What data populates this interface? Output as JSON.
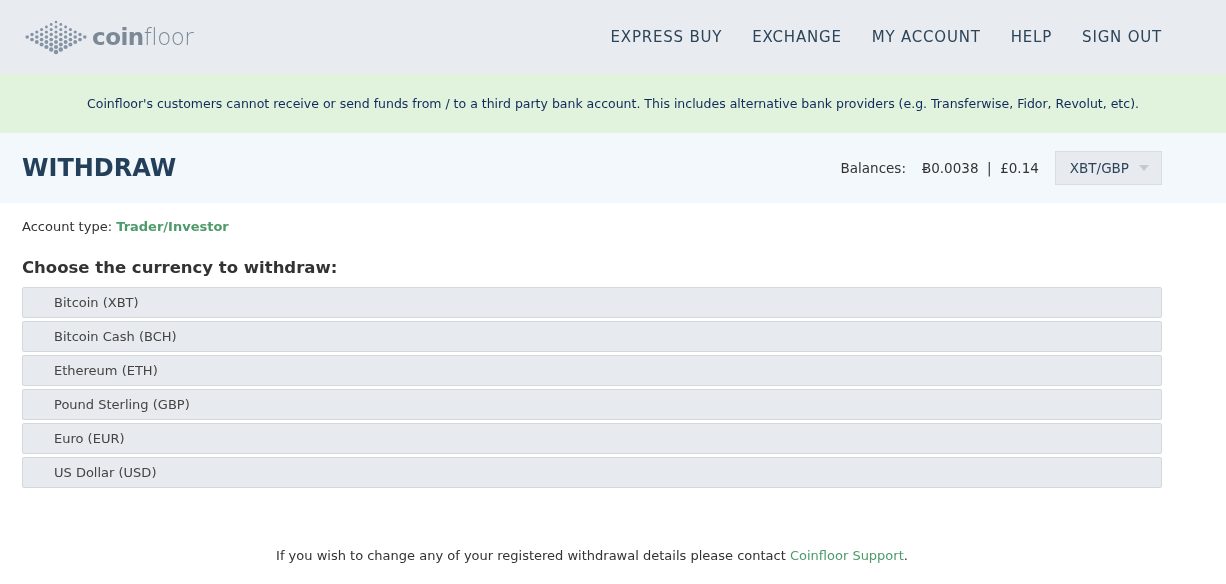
{
  "logo": {
    "text": "**coin**floor"
  },
  "nav": [
    {
      "label": "EXPRESS BUY"
    },
    {
      "label": "EXCHANGE"
    },
    {
      "label": "MY ACCOUNT"
    },
    {
      "label": "HELP"
    },
    {
      "label": "SIGN OUT"
    }
  ],
  "notice": "Coinfloor's customers cannot receive or send funds from / to a third party bank account. This includes alternative bank providers (e.g. Transferwise, Fidor, Revolut, etc).",
  "page_title": "WITHDRAW",
  "balances": {
    "label": "Balances:",
    "values": "Ƀ0.0038  |  £0.14",
    "market": "XBT/GBP"
  },
  "account_type": {
    "label": "Account type:",
    "value": "Trader/Investor"
  },
  "heading": "Choose the currency to withdraw:",
  "currencies": [
    "Bitcoin (XBT)",
    "Bitcoin Cash (BCH)",
    "Ethereum (ETH)",
    "Pound Sterling (GBP)",
    "Euro (EUR)",
    "US Dollar (USD)"
  ],
  "footer": {
    "text": "If you wish to change any of your registered withdrawal details please contact ",
    "link": "Coinfloor Support",
    "end": "."
  }
}
